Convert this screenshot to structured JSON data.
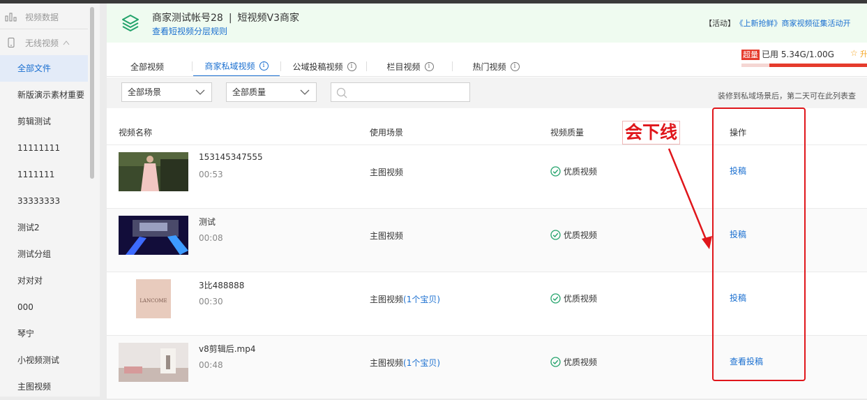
{
  "sidebar": {
    "header_label": "视频数据",
    "group_label": "无线视频",
    "items": [
      {
        "label": "全部文件",
        "active": true
      },
      {
        "label": "新版演示素材重要",
        "active": false
      },
      {
        "label": "剪辑测试",
        "active": false
      },
      {
        "label": "11111111",
        "active": false
      },
      {
        "label": "1111111",
        "active": false
      },
      {
        "label": "33333333",
        "active": false
      },
      {
        "label": "测试2",
        "active": false
      },
      {
        "label": "测试分组",
        "active": false
      },
      {
        "label": "对对对",
        "active": false
      },
      {
        "label": "000",
        "active": false
      },
      {
        "label": "琴宁",
        "active": false
      },
      {
        "label": "小视频测试",
        "active": false
      },
      {
        "label": "主图视频",
        "active": false
      }
    ]
  },
  "banner": {
    "account_name": "商家测试帐号28",
    "divider": "|",
    "account_level": "短视频V3商家",
    "rule_link": "查看短视频分层规则",
    "activity_tag": "【活动】",
    "activity_link": "《上新抢鲜》商家视频征集活动开"
  },
  "storage": {
    "badge": "超量",
    "used_text": "已用 5.34G/1.00G",
    "upgrade_label": "升",
    "usage_fraction": 1.0
  },
  "tabs": [
    {
      "label": "全部视频",
      "info": false,
      "active": false
    },
    {
      "label": "商家私域视频",
      "info": true,
      "active": true
    },
    {
      "label": "公域投稿视频",
      "info": true,
      "active": false
    },
    {
      "label": "栏目视频",
      "info": true,
      "active": false
    },
    {
      "label": "热门视频",
      "info": true,
      "active": false
    }
  ],
  "info_glyph": "i",
  "filters": {
    "scene_select": "全部场景",
    "quality_select": "全部质量",
    "search_placeholder": "",
    "note": "装修到私域场景后，第二天可在此列表查"
  },
  "table": {
    "headers": {
      "name": "视频名称",
      "scene": "使用场景",
      "quality": "视频质量",
      "op": "操作"
    },
    "rows": [
      {
        "name": "153145347555",
        "duration": "00:53",
        "scene": "主图视频",
        "goods": "",
        "quality": "优质视频",
        "op": "投稿",
        "thumb": "woman-icon"
      },
      {
        "name": "测试",
        "duration": "00:08",
        "scene": "主图视频",
        "goods": "",
        "quality": "优质视频",
        "op": "投稿",
        "thumb": "stage-icon"
      },
      {
        "name": "3比488888",
        "duration": "00:30",
        "scene": "主图视频",
        "goods": "(1个宝贝)",
        "quality": "优质视频",
        "op": "投稿",
        "thumb": "lancome-icon"
      },
      {
        "name": "v8剪辑后.mp4",
        "duration": "00:48",
        "scene": "主图视频",
        "goods": "(1个宝贝)",
        "quality": "优质视频",
        "op": "查看投稿",
        "thumb": "room-icon"
      }
    ]
  },
  "annotation": {
    "text": "会下线"
  },
  "brand_logo_text": "LANCOME",
  "colors": {
    "accent": "#1a6fd0",
    "success": "#23a36b",
    "annotation": "#e0161b",
    "banner_bg": "#effbf0"
  }
}
